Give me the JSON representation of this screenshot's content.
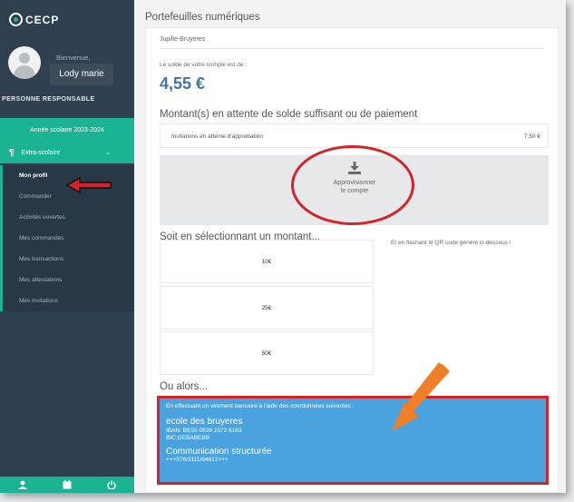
{
  "sidebar": {
    "logo": "CECP",
    "welcome": "Bienvenue,",
    "username": "Lody marie",
    "role": "PERSONNE RESPONSABLE",
    "year": "Année scolaire 2023-2024",
    "menu_head": "Extra-scolaire",
    "items": [
      {
        "label": "Mon profil"
      },
      {
        "label": "Commander"
      },
      {
        "label": "Activités ouvertes"
      },
      {
        "label": "Mes commandes"
      },
      {
        "label": "Mes transactions"
      },
      {
        "label": "Mes attestations"
      },
      {
        "label": "Mes invitations"
      }
    ],
    "bottom_icons": [
      "user-icon",
      "calendar-icon",
      "power-icon"
    ]
  },
  "main": {
    "title": "Portefeuilles numériques",
    "card_head": "Jupille-Bruyeres",
    "solde_label": "Le solde de votre compte est de :",
    "solde": "4,55 €",
    "pending_title": "Montant(s) en attente de solde suffisant ou de paiement",
    "pending_label": "Invitations en attente d'approbation",
    "pending_amount": "7,50 €",
    "supply_line1": "Approvisionner",
    "supply_line2": "le compte",
    "select_title": "Soit en sélectionnant un montant...",
    "amounts": [
      "10€",
      "25€",
      "50€"
    ],
    "qr_text": "Et en flashant le QR code généré ci-dessous !",
    "or_title": "Ou alors...",
    "bank": {
      "intro": "En effectuant un virement bancaire à l'aide des coordonnées suivantes :",
      "school": "ecole des bruyeres",
      "iban": "IBAN: BE55 0639 2372 6183",
      "bic": "BIC:GEBABEBB",
      "comm_title": "Communication structurée",
      "comm_value": "+++576/3111/64612+++"
    }
  },
  "colors": {
    "sidebar": "#2f4050",
    "accent": "#1ab394",
    "balance": "#4472a4",
    "bank_box": "#4aa3df",
    "annotation_red": "#d3242b",
    "annotation_orange": "#f07f27"
  }
}
